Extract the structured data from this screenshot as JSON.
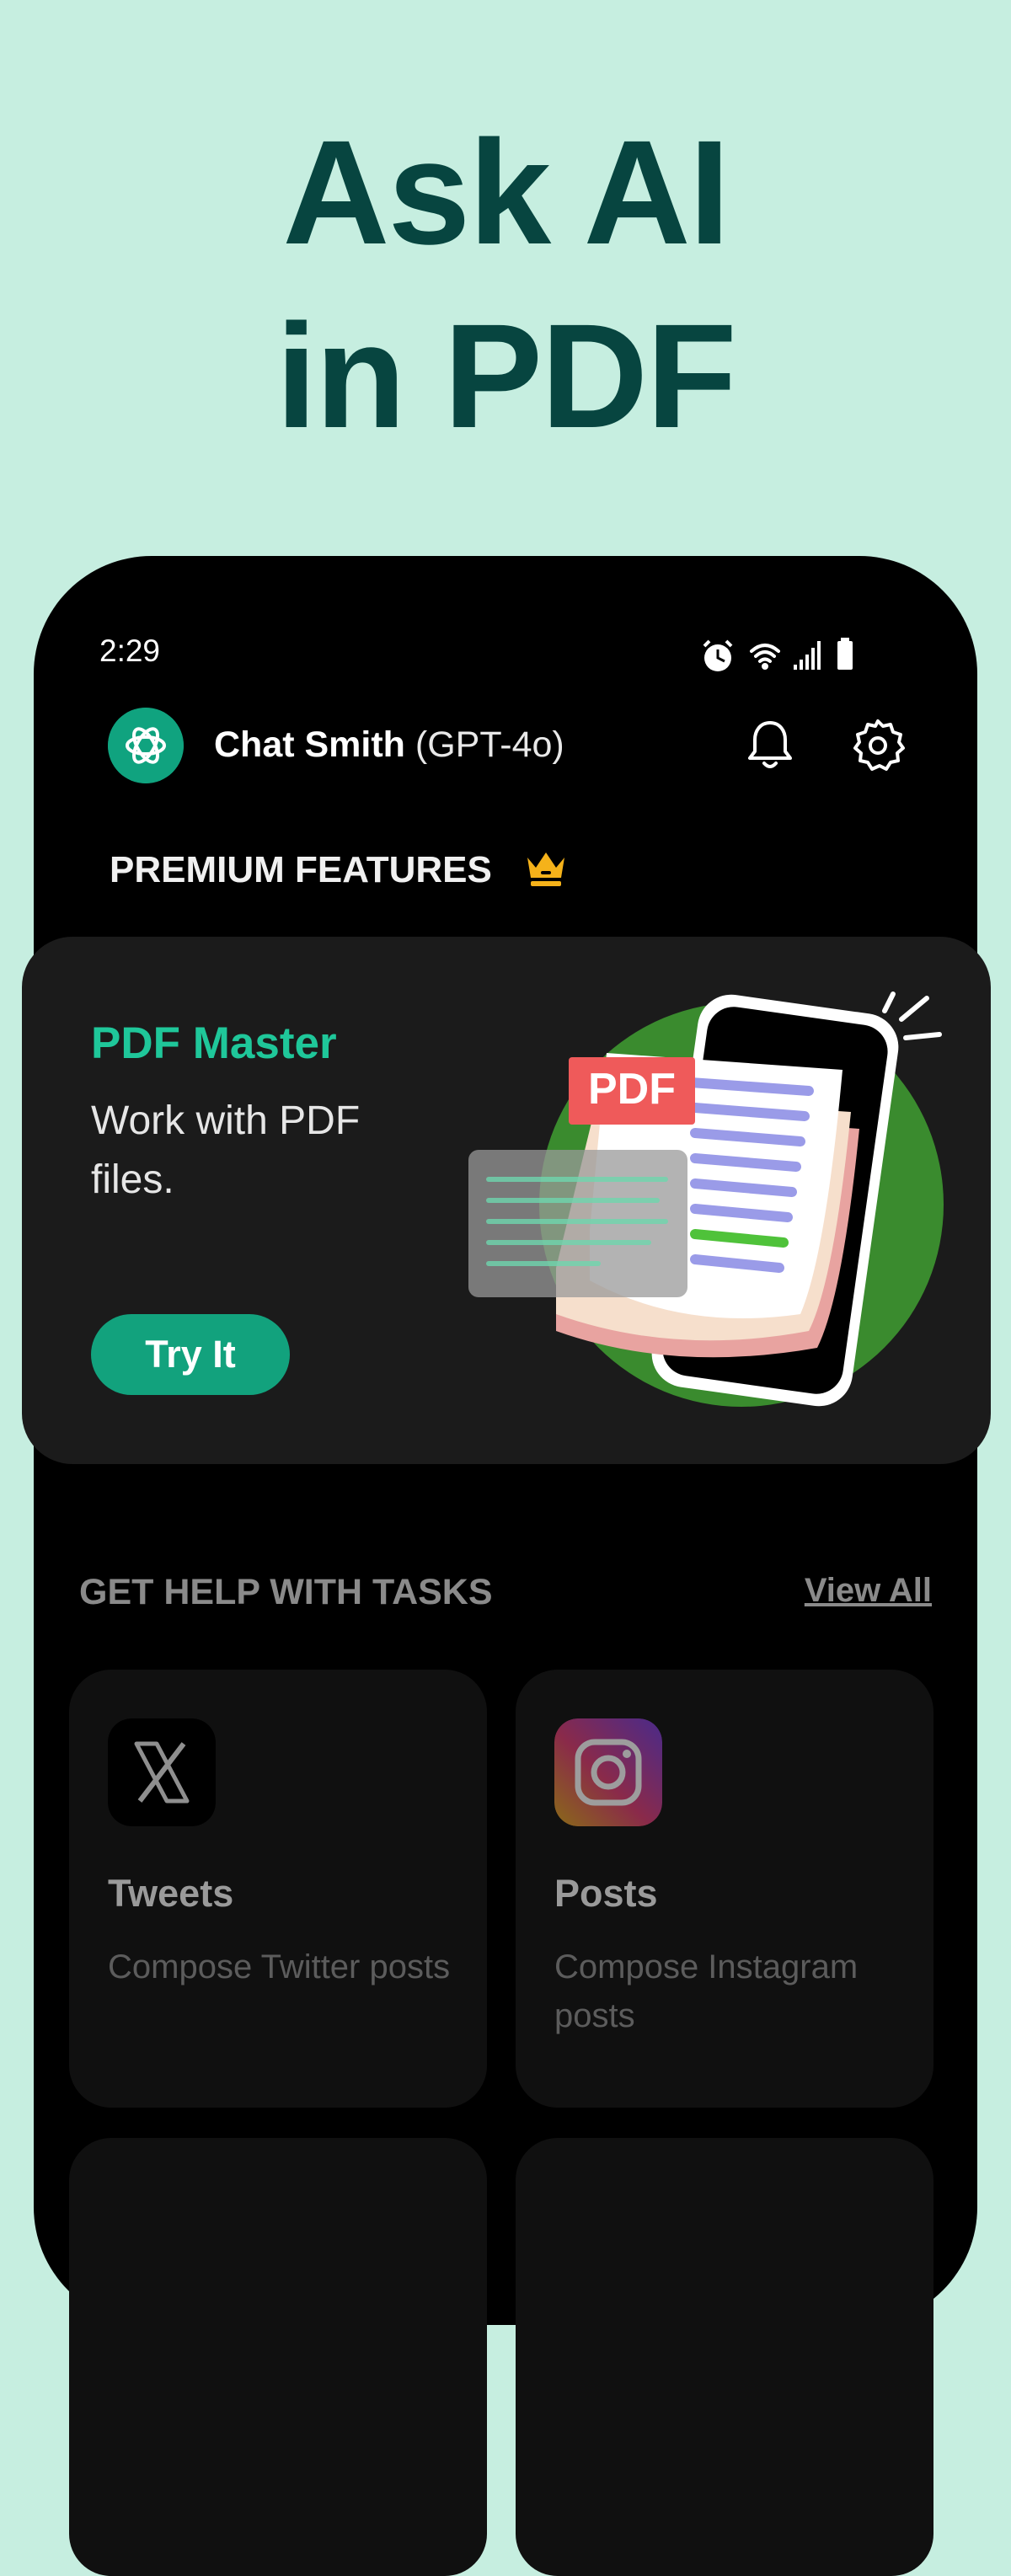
{
  "headline": {
    "line1": "Ask AI",
    "line2": "in PDF"
  },
  "status_bar": {
    "time": "2:29",
    "icons": [
      "alarm-icon",
      "wifi-icon",
      "signal-icon",
      "battery-icon"
    ]
  },
  "header": {
    "app_name": "Chat Smith",
    "model": "(GPT-4o)",
    "actions": [
      "bell-icon",
      "gear-icon"
    ]
  },
  "premium": {
    "label": "PREMIUM FEATURES",
    "icon": "crown-icon"
  },
  "promo": {
    "title": "PDF Master",
    "description": "Work with PDF files.",
    "button": "Try It",
    "illustration_badge": "PDF"
  },
  "tasks": {
    "label": "GET HELP WITH TASKS",
    "view_all": "View All",
    "items": [
      {
        "title": "Tweets",
        "description": "Compose Twitter posts",
        "icon": "x-logo-icon"
      },
      {
        "title": "Posts",
        "description": "Compose Instagram posts",
        "icon": "instagram-icon"
      }
    ]
  },
  "colors": {
    "background": "#c6eee0",
    "headline": "#074540",
    "accent": "#12a27d",
    "promo_title": "#1fc79a"
  }
}
